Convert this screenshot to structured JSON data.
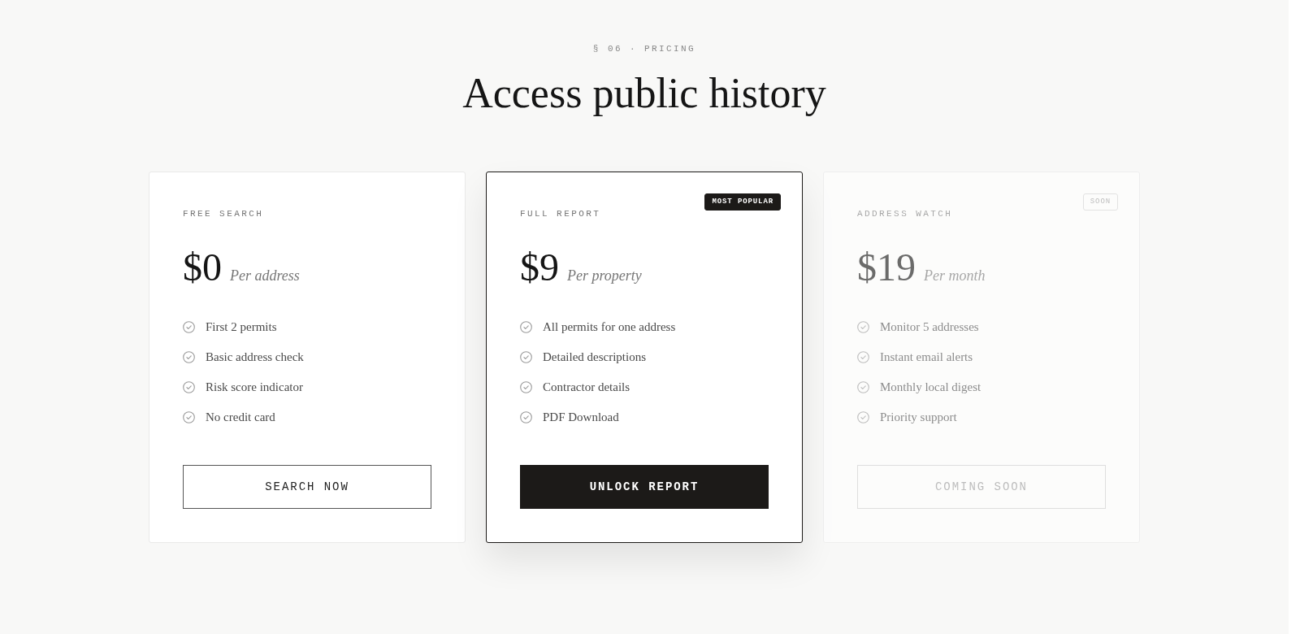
{
  "section_label": "§ 06 · PRICING",
  "title": "Access public history",
  "plans": [
    {
      "name": "FREE SEARCH",
      "highlighted": false,
      "disabled": false,
      "price": "$0",
      "unit": "Per address",
      "features": [
        "First 2 permits",
        "Basic address check",
        "Risk score indicator",
        "No credit card"
      ],
      "button": {
        "label": "SEARCH NOW",
        "kind": "outline"
      }
    },
    {
      "name": "FULL REPORT",
      "highlighted": true,
      "disabled": false,
      "badge": {
        "label": "MOST POPULAR",
        "kind": "filled"
      },
      "price": "$9",
      "unit": "Per property",
      "features": [
        "All permits for one address",
        "Detailed descriptions",
        "Contractor details",
        "PDF Download"
      ],
      "button": {
        "label": "UNLOCK REPORT",
        "kind": "solid"
      }
    },
    {
      "name": "ADDRESS WATCH",
      "highlighted": false,
      "disabled": true,
      "badge": {
        "label": "SOON",
        "kind": "outline"
      },
      "price": "$19",
      "unit": "Per month",
      "features": [
        "Monitor 5 addresses",
        "Instant email alerts",
        "Monthly local digest",
        "Priority support"
      ],
      "button": {
        "label": "COMING SOON",
        "kind": "outline"
      }
    }
  ]
}
